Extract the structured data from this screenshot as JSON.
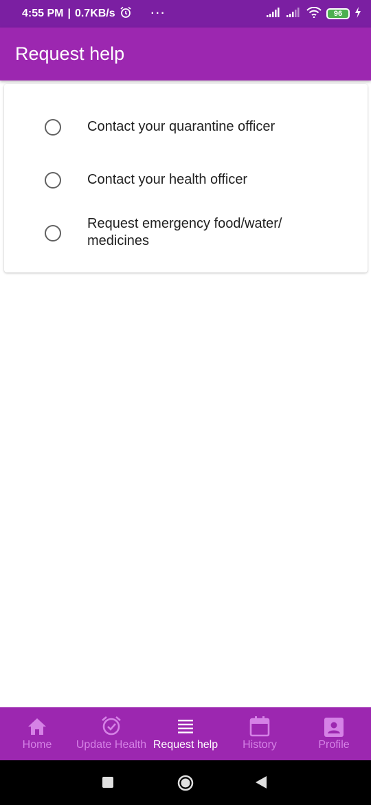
{
  "status_bar": {
    "time": "4:55 PM",
    "separator": "|",
    "speed": "0.7KB/s",
    "dots": "···",
    "battery": "96"
  },
  "app_bar": {
    "title": "Request help"
  },
  "options": [
    {
      "label": "Contact your quarantine officer"
    },
    {
      "label": "Contact your health officer"
    },
    {
      "label": "Request emergency food/water/ medicines"
    }
  ],
  "bottom_nav": {
    "items": [
      {
        "label": "Home",
        "icon": "home-icon"
      },
      {
        "label": "Update Health",
        "icon": "alarm-check-icon"
      },
      {
        "label": "Request help",
        "icon": "list-icon",
        "active": true
      },
      {
        "label": "History",
        "icon": "calendar-icon"
      },
      {
        "label": "Profile",
        "icon": "account-box-icon"
      }
    ]
  },
  "colors": {
    "status_bar": "#7b1fa2",
    "primary": "#9c27b0",
    "nav_inactive": "#d582e6"
  }
}
